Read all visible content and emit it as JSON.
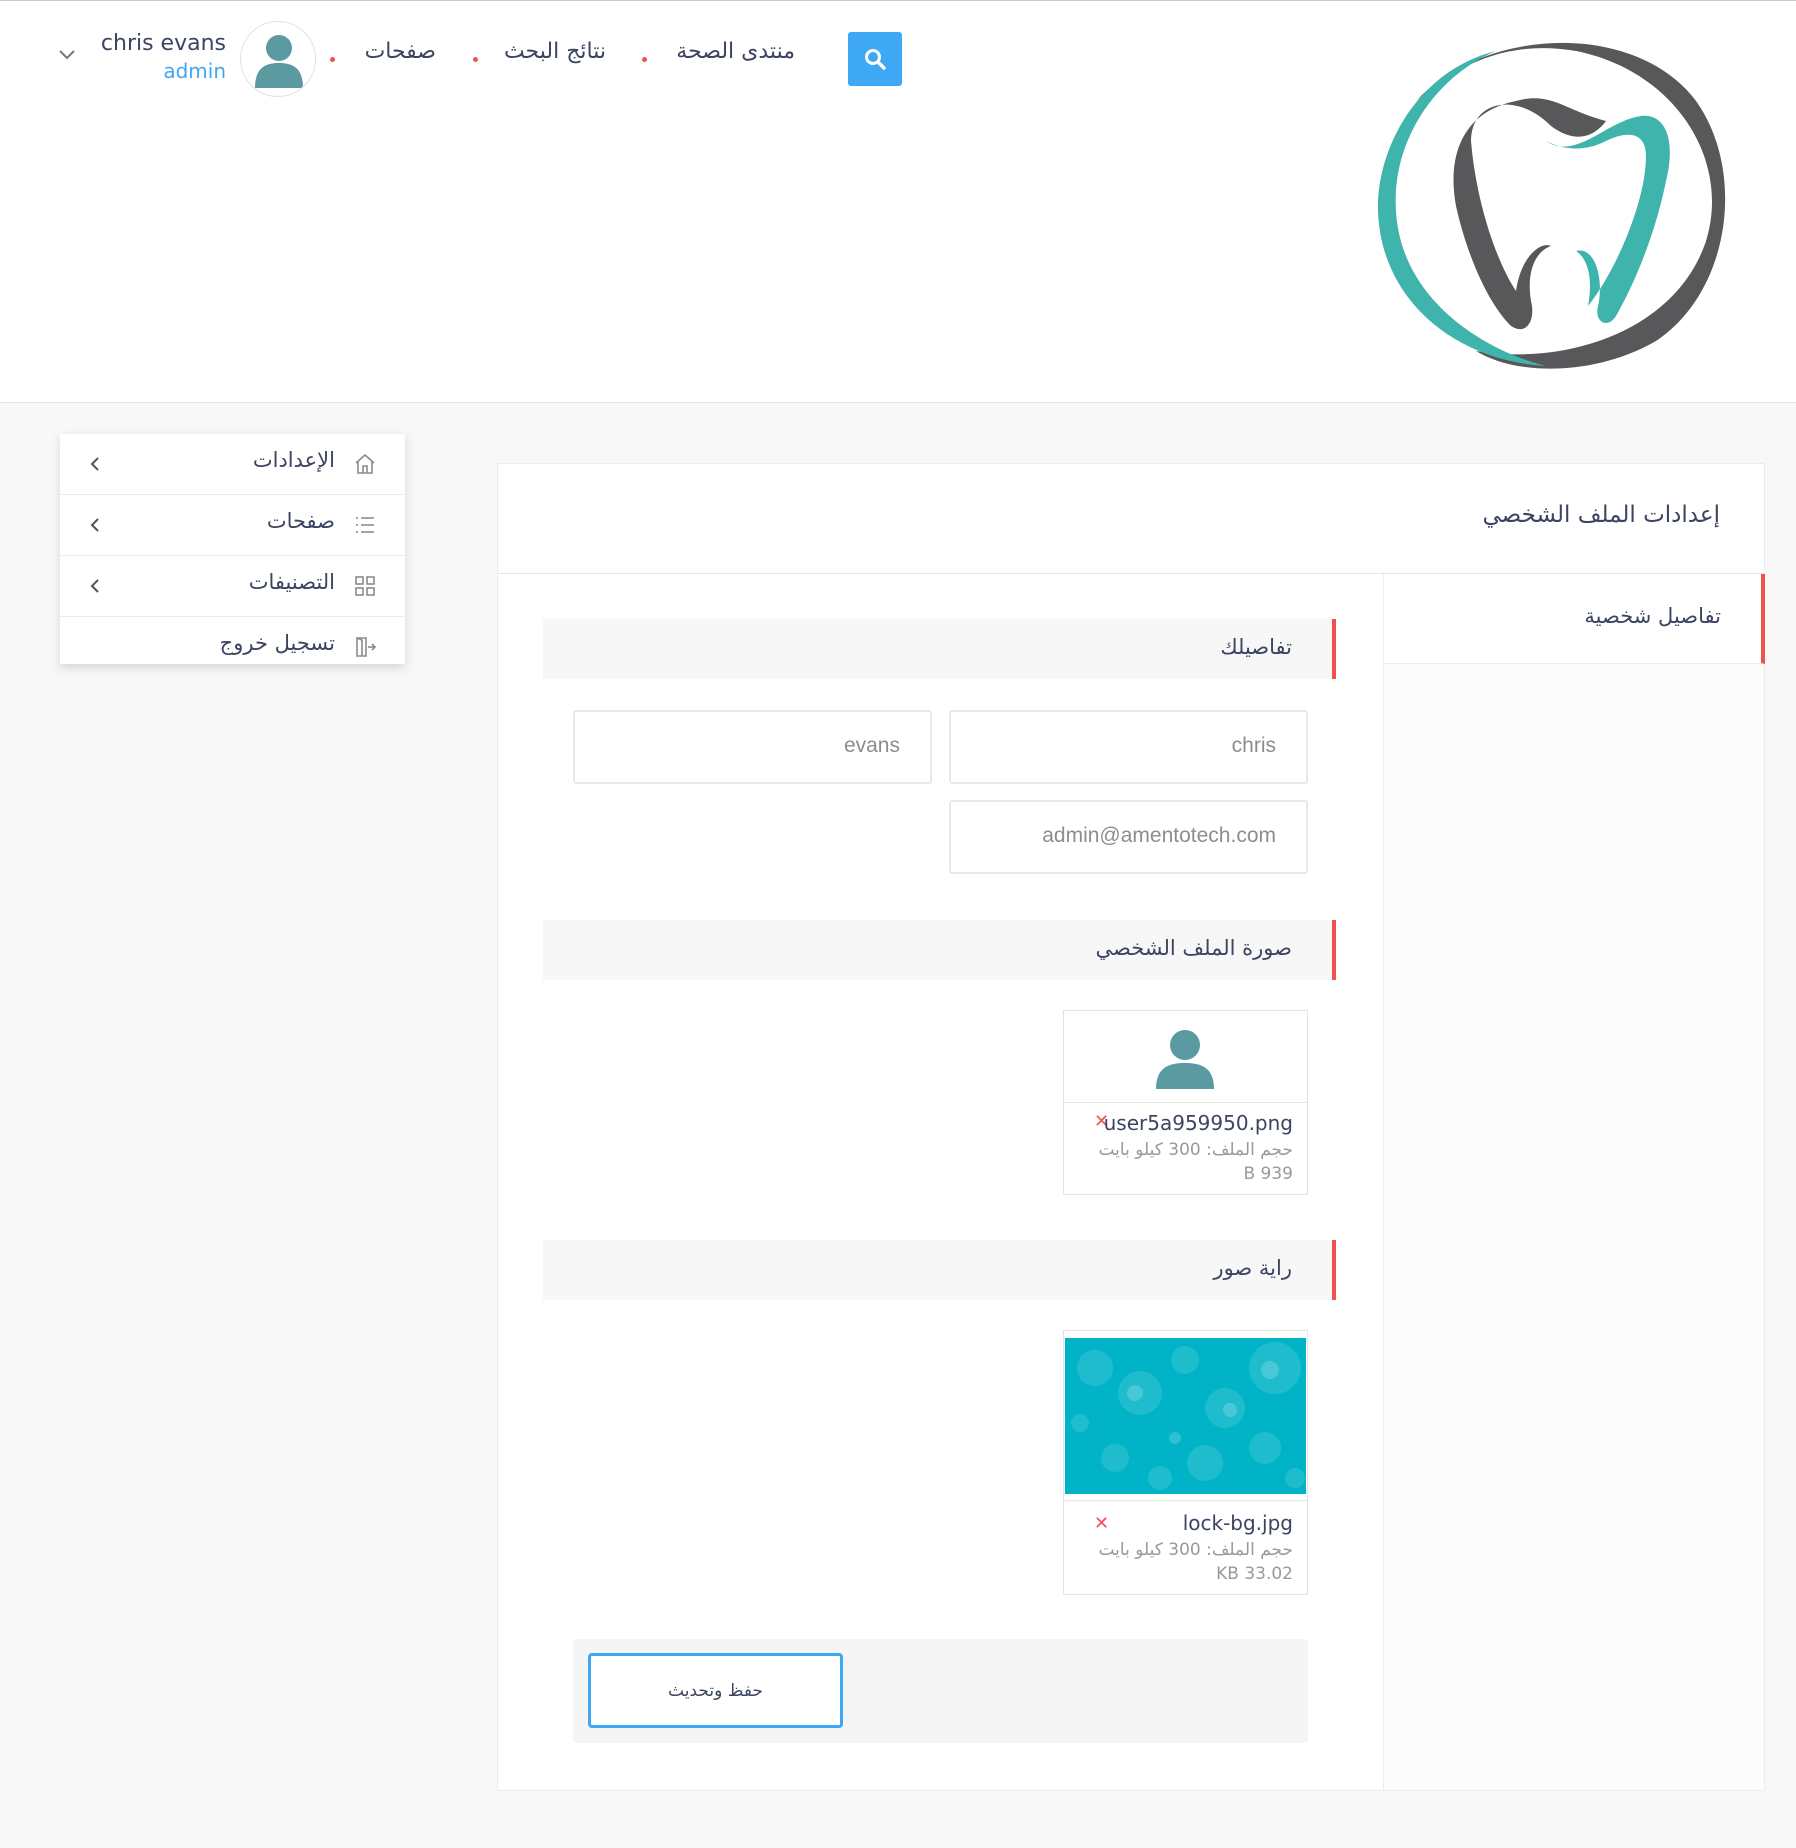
{
  "header": {
    "logo_name": "tooth-logo",
    "nav": [
      {
        "label": "منتدى الصحة"
      },
      {
        "label": "نتائج البحث"
      },
      {
        "label": "صفحات"
      }
    ],
    "user": {
      "name": "chris evans",
      "role": "admin"
    }
  },
  "side_menu": {
    "items": [
      {
        "label": "الإعدادات",
        "icon": "home-icon"
      },
      {
        "label": "صفحات",
        "icon": "list-icon"
      },
      {
        "label": "التصنيفات",
        "icon": "grid-icon"
      },
      {
        "label": "تسجيل خروج",
        "icon": "logout-icon"
      }
    ]
  },
  "card": {
    "title": "إعدادات الملف الشخصي",
    "tab": "تفاصيل شخصية",
    "sections": {
      "details": "تفاصيلك",
      "profile_photo": "صورة الملف الشخصي",
      "banner": "راية صور"
    },
    "fields": {
      "first_name": "chris",
      "last_name": "evans",
      "email": "admin@amentotech.com"
    },
    "files": [
      {
        "name": "user5a959950.png",
        "size_label": "حجم الملف: 300 كيلو بايت",
        "size": "B 939"
      },
      {
        "name": "lock-bg.jpg",
        "size_label": "حجم الملف: 300 كيلو بايت",
        "size": "KB 33.02"
      }
    ],
    "save_label": "حفظ وتحديث"
  },
  "colors": {
    "accent": "#3fa8f4",
    "marker": "#ef5350",
    "avatar": "#5a9aa0",
    "logo_teal": "#3fb4ad",
    "logo_grey": "#58585a",
    "banner": "#00b3c6"
  }
}
